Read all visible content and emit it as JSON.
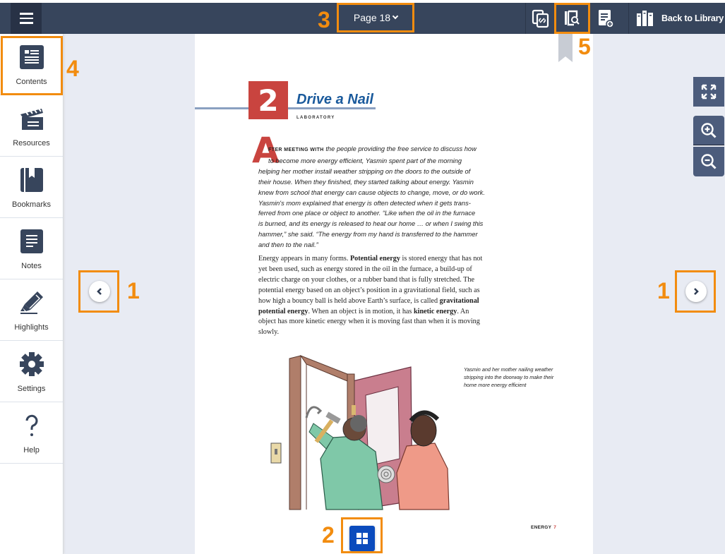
{
  "topbar": {
    "menu_icon": "hamburger-icon",
    "page_selector": "Page 18",
    "icons": [
      "linked-copy-icon",
      "book-search-icon",
      "add-note-icon",
      "library-books-icon"
    ],
    "back_to_library": "Back to Library"
  },
  "sidebar": {
    "items": [
      {
        "label": "Contents",
        "icon": "contents-icon"
      },
      {
        "label": "Resources",
        "icon": "clapperboard-icon"
      },
      {
        "label": "Bookmarks",
        "icon": "bookmark-book-icon"
      },
      {
        "label": "Notes",
        "icon": "notes-icon"
      },
      {
        "label": "Highlights",
        "icon": "highlighter-icon"
      },
      {
        "label": "Settings",
        "icon": "gear-icon"
      },
      {
        "label": "Help",
        "icon": "question-icon"
      }
    ]
  },
  "page": {
    "chapter_number": "2",
    "chapter_title": "Drive a Nail",
    "chapter_subtitle": "LABORATORY",
    "dropcap": "A",
    "intro_smallcaps": "fter meeting with",
    "intro_lines": [
      "the people providing the free service to discuss how",
      "to become more energy efficient, Yasmin spent part of the morning",
      "helping her mother install weather stripping on the doors to the outside of",
      "their house. When they finished, they started talking about energy. Yasmin",
      "knew from school that energy can cause objects to change, move, or do work.",
      "Yasmin's mom explained that energy is often detected when it gets trans-",
      "ferred from one place or object to another. “Like when the oil in the furnace",
      "is burned, and its energy is released to heat our home … or when I swing this",
      "hammer,” she said. “The energy from my hand is transferred to the hammer",
      "and then to the nail.”"
    ],
    "body": {
      "p1_a": "Energy appears in many forms. ",
      "term1": "Potential energy",
      "p1_b": " is stored energy that has not yet been used, such as energy stored in the oil in the furnace, a build-up of electric charge on your clothes, or a rubber band that is fully stretched. The potential energy based on an object’s position in a gravitational field, such as how high a bouncy ball is held above Earth’s surface, is called ",
      "term2": "gravitational potential energy",
      "p1_c": ". When an object is in motion, it has ",
      "term3": "kinetic energy",
      "p1_d": ". An object has more kinetic energy when it is moving fast than when it is moving slowly."
    },
    "caption": "Yasmin and her mother nailing weather stripping into the doorway to make their home more energy efficient",
    "folio_label": "ENERGY",
    "folio_number": "7"
  },
  "controls": {
    "prev_icon": "chevron-left-icon",
    "next_icon": "chevron-right-icon",
    "grid_icon": "grid-icon",
    "fullscreen_icon": "expand-icon",
    "zoom_in_icon": "zoom-in-icon",
    "zoom_out_icon": "zoom-out-icon"
  },
  "callouts": {
    "prev": "1",
    "next": "1",
    "grid": "2",
    "page": "3",
    "contents": "4",
    "search": "5"
  },
  "colors": {
    "topbar": "#37455c",
    "accent_callout": "#f28c0f",
    "chapter_red": "#c9443f",
    "title_blue": "#1a5a9c",
    "grid_button": "#0b4bbd",
    "reader_bg": "#e8ebf3"
  }
}
